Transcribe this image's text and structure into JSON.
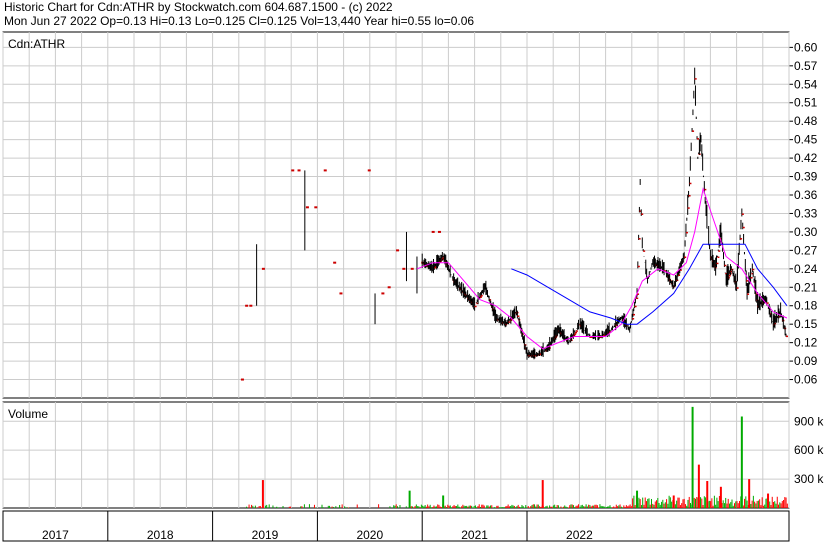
{
  "header": {
    "line1": "Historic Chart for Cdn:ATHR by Stockwatch.com 604.687.1500 - (c) 2022",
    "line2": "Mon Jun 27 2022  Op=0.13  Hi=0.13  Lo=0.125  Cl=0.125  Vol=13,440  Year hi=0.55  lo=0.06"
  },
  "chart_data": {
    "type": "line",
    "title": "Cdn:ATHR",
    "price_axis": {
      "ticks": [
        "0.60",
        "0.57",
        "0.54",
        "0.51",
        "0.48",
        "0.45",
        "0.42",
        "0.39",
        "0.36",
        "0.33",
        "0.30",
        "0.27",
        "0.24",
        "0.21",
        "0.18",
        "0.15",
        "0.12",
        "0.09",
        "0.06"
      ],
      "ylim": [
        0.03,
        0.625
      ]
    },
    "volume_axis": {
      "label": "Volume",
      "ticks": [
        "900 k",
        "600 k",
        "300 k"
      ],
      "ylim": [
        0,
        1100000
      ]
    },
    "x_labels": [
      "2017",
      "2018",
      "2019",
      "2020",
      "2021",
      "2022"
    ],
    "colors": {
      "price": "#000000",
      "ma_short": "#ff00ff",
      "ma_long": "#0000ff",
      "volume": "#ff0000",
      "volume_alt": "#00aa00",
      "grid": "#cccccc"
    },
    "sparse_trades": [
      {
        "t": 2019.28,
        "p": 0.06
      },
      {
        "t": 2019.32,
        "p": 0.18
      },
      {
        "t": 2019.36,
        "p": 0.18
      },
      {
        "t": 2019.48,
        "p": 0.24
      },
      {
        "t": 2019.76,
        "p": 0.4
      },
      {
        "t": 2019.82,
        "p": 0.4
      },
      {
        "t": 2019.9,
        "p": 0.34
      },
      {
        "t": 2019.98,
        "p": 0.34
      },
      {
        "t": 2020.07,
        "p": 0.4
      },
      {
        "t": 2020.16,
        "p": 0.25
      },
      {
        "t": 2020.22,
        "p": 0.2
      },
      {
        "t": 2020.49,
        "p": 0.4
      },
      {
        "t": 2020.62,
        "p": 0.2
      },
      {
        "t": 2020.68,
        "p": 0.21
      },
      {
        "t": 2020.76,
        "p": 0.27
      },
      {
        "t": 2020.82,
        "p": 0.24
      },
      {
        "t": 2020.9,
        "p": 0.24
      },
      {
        "t": 2021.0,
        "p": 0.25
      },
      {
        "t": 2021.1,
        "p": 0.3
      },
      {
        "t": 2021.16,
        "p": 0.3
      }
    ],
    "bars": [
      {
        "t": 2019.42,
        "lo": 0.18,
        "hi": 0.28
      },
      {
        "t": 2019.88,
        "lo": 0.27,
        "hi": 0.4
      },
      {
        "t": 2020.55,
        "lo": 0.15,
        "hi": 0.2
      },
      {
        "t": 2020.85,
        "lo": 0.22,
        "hi": 0.3
      },
      {
        "t": 2020.95,
        "lo": 0.2,
        "hi": 0.26
      }
    ],
    "price_path": [
      {
        "t": 2021.0,
        "p": 0.25
      },
      {
        "t": 2021.1,
        "p": 0.24
      },
      {
        "t": 2021.2,
        "p": 0.26
      },
      {
        "t": 2021.3,
        "p": 0.22
      },
      {
        "t": 2021.4,
        "p": 0.2
      },
      {
        "t": 2021.5,
        "p": 0.18
      },
      {
        "t": 2021.6,
        "p": 0.21
      },
      {
        "t": 2021.7,
        "p": 0.16
      },
      {
        "t": 2021.8,
        "p": 0.15
      },
      {
        "t": 2021.9,
        "p": 0.17
      },
      {
        "t": 2022.0,
        "p": 0.1
      },
      {
        "t": 2022.05,
        "p": 0.1
      },
      {
        "t": 2022.1,
        "p": 0.1
      },
      {
        "t": 2022.2,
        "p": 0.11
      },
      {
        "t": 2022.3,
        "p": 0.14
      },
      {
        "t": 2022.4,
        "p": 0.12
      },
      {
        "t": 2022.5,
        "p": 0.15
      },
      {
        "t": 2022.6,
        "p": 0.13
      },
      {
        "t": 2022.7,
        "p": 0.13
      },
      {
        "t": 2022.8,
        "p": 0.14
      },
      {
        "t": 2022.9,
        "p": 0.16
      },
      {
        "t": 2022.98,
        "p": 0.14
      },
      {
        "t": 2023.05,
        "p": 0.2
      },
      {
        "t": 2023.08,
        "p": 0.38
      },
      {
        "t": 2023.1,
        "p": 0.28
      },
      {
        "t": 2023.15,
        "p": 0.22
      },
      {
        "t": 2023.2,
        "p": 0.25
      },
      {
        "t": 2023.3,
        "p": 0.24
      },
      {
        "t": 2023.4,
        "p": 0.21
      },
      {
        "t": 2023.5,
        "p": 0.26
      },
      {
        "t": 2023.55,
        "p": 0.38
      },
      {
        "t": 2023.6,
        "p": 0.55
      },
      {
        "t": 2023.63,
        "p": 0.42
      },
      {
        "t": 2023.66,
        "p": 0.45
      },
      {
        "t": 2023.7,
        "p": 0.35
      },
      {
        "t": 2023.75,
        "p": 0.26
      },
      {
        "t": 2023.8,
        "p": 0.24
      },
      {
        "t": 2023.85,
        "p": 0.3
      },
      {
        "t": 2023.9,
        "p": 0.22
      },
      {
        "t": 2023.95,
        "p": 0.24
      },
      {
        "t": 2024.0,
        "p": 0.21
      },
      {
        "t": 2024.05,
        "p": 0.33
      },
      {
        "t": 2024.1,
        "p": 0.2
      },
      {
        "t": 2024.15,
        "p": 0.24
      },
      {
        "t": 2024.2,
        "p": 0.18
      },
      {
        "t": 2024.28,
        "p": 0.19
      },
      {
        "t": 2024.35,
        "p": 0.15
      },
      {
        "t": 2024.42,
        "p": 0.17
      },
      {
        "t": 2024.48,
        "p": 0.125
      }
    ],
    "ma_short": [
      {
        "t": 2020.95,
        "p": 0.24
      },
      {
        "t": 2021.1,
        "p": 0.25
      },
      {
        "t": 2021.25,
        "p": 0.25
      },
      {
        "t": 2021.4,
        "p": 0.22
      },
      {
        "t": 2021.55,
        "p": 0.19
      },
      {
        "t": 2021.7,
        "p": 0.18
      },
      {
        "t": 2021.85,
        "p": 0.16
      },
      {
        "t": 2022.0,
        "p": 0.13
      },
      {
        "t": 2022.15,
        "p": 0.11
      },
      {
        "t": 2022.3,
        "p": 0.12
      },
      {
        "t": 2022.45,
        "p": 0.13
      },
      {
        "t": 2022.6,
        "p": 0.13
      },
      {
        "t": 2022.75,
        "p": 0.13
      },
      {
        "t": 2022.9,
        "p": 0.15
      },
      {
        "t": 2023.0,
        "p": 0.18
      },
      {
        "t": 2023.1,
        "p": 0.22
      },
      {
        "t": 2023.25,
        "p": 0.24
      },
      {
        "t": 2023.4,
        "p": 0.23
      },
      {
        "t": 2023.52,
        "p": 0.25
      },
      {
        "t": 2023.6,
        "p": 0.3
      },
      {
        "t": 2023.68,
        "p": 0.37
      },
      {
        "t": 2023.78,
        "p": 0.32
      },
      {
        "t": 2023.9,
        "p": 0.26
      },
      {
        "t": 2024.05,
        "p": 0.24
      },
      {
        "t": 2024.2,
        "p": 0.2
      },
      {
        "t": 2024.35,
        "p": 0.17
      },
      {
        "t": 2024.48,
        "p": 0.16
      }
    ],
    "ma_long": [
      {
        "t": 2021.85,
        "p": 0.24
      },
      {
        "t": 2022.0,
        "p": 0.23
      },
      {
        "t": 2022.2,
        "p": 0.21
      },
      {
        "t": 2022.4,
        "p": 0.19
      },
      {
        "t": 2022.6,
        "p": 0.17
      },
      {
        "t": 2022.8,
        "p": 0.16
      },
      {
        "t": 2022.95,
        "p": 0.15
      },
      {
        "t": 2023.05,
        "p": 0.15
      },
      {
        "t": 2023.2,
        "p": 0.17
      },
      {
        "t": 2023.4,
        "p": 0.2
      },
      {
        "t": 2023.55,
        "p": 0.24
      },
      {
        "t": 2023.68,
        "p": 0.28
      },
      {
        "t": 2023.8,
        "p": 0.28
      },
      {
        "t": 2023.95,
        "p": 0.28
      },
      {
        "t": 2024.08,
        "p": 0.28
      },
      {
        "t": 2024.2,
        "p": 0.24
      },
      {
        "t": 2024.35,
        "p": 0.21
      },
      {
        "t": 2024.48,
        "p": 0.18
      }
    ],
    "volume_spikes": [
      {
        "t": 2019.48,
        "v": 290000,
        "c": "red"
      },
      {
        "t": 2020.88,
        "v": 180000,
        "c": "green"
      },
      {
        "t": 2021.2,
        "v": 130000,
        "c": "green"
      },
      {
        "t": 2022.15,
        "v": 290000,
        "c": "red"
      },
      {
        "t": 2023.05,
        "v": 180000,
        "c": "green"
      },
      {
        "t": 2023.4,
        "v": 130000,
        "c": "red"
      },
      {
        "t": 2023.58,
        "v": 1050000,
        "c": "green"
      },
      {
        "t": 2023.64,
        "v": 450000,
        "c": "red"
      },
      {
        "t": 2023.72,
        "v": 280000,
        "c": "red"
      },
      {
        "t": 2023.85,
        "v": 220000,
        "c": "red"
      },
      {
        "t": 2024.05,
        "v": 950000,
        "c": "green"
      },
      {
        "t": 2024.12,
        "v": 300000,
        "c": "red"
      },
      {
        "t": 2024.3,
        "v": 150000,
        "c": "red"
      }
    ]
  }
}
